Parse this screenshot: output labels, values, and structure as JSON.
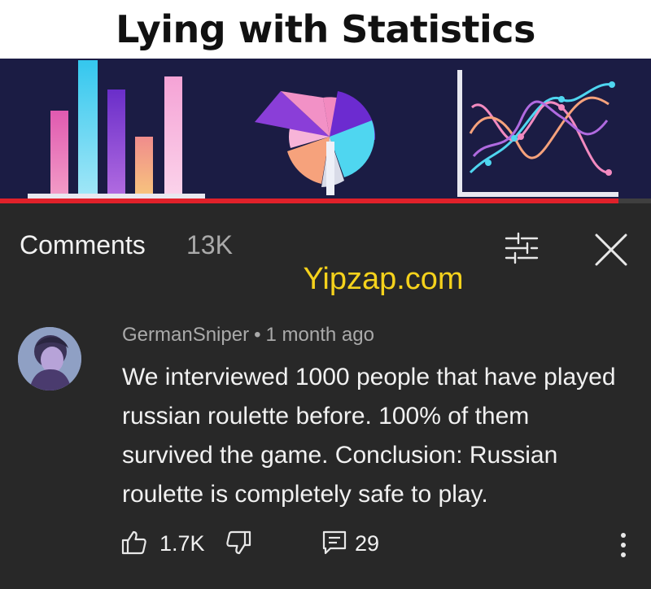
{
  "thumbnail": {
    "title": "Lying with Statistics",
    "progress_fraction": 0.95,
    "colors": {
      "background": "#1b1c44",
      "pink": "#f28ac0",
      "cyan": "#4fd6f0",
      "purple": "#7a3ad6",
      "peach": "#f6a27c",
      "progress": "#e0212a"
    }
  },
  "comments_header": {
    "title": "Comments",
    "count": "13K",
    "sort_icon": "sort-icon",
    "close_icon": "close-icon"
  },
  "watermark": "Yipzap.com",
  "comment": {
    "author": "GermanSniper",
    "separator": "•",
    "time": "1 month ago",
    "text": "We interviewed 1000 people that have played russian roulette before. 100% of them survived the game. Conclusion: Russian roulette is completely safe to play.",
    "likes": "1.7K",
    "replies": "29",
    "icons": [
      "thumbs-up-icon",
      "thumbs-down-icon",
      "reply-icon",
      "more-vert-icon"
    ]
  }
}
